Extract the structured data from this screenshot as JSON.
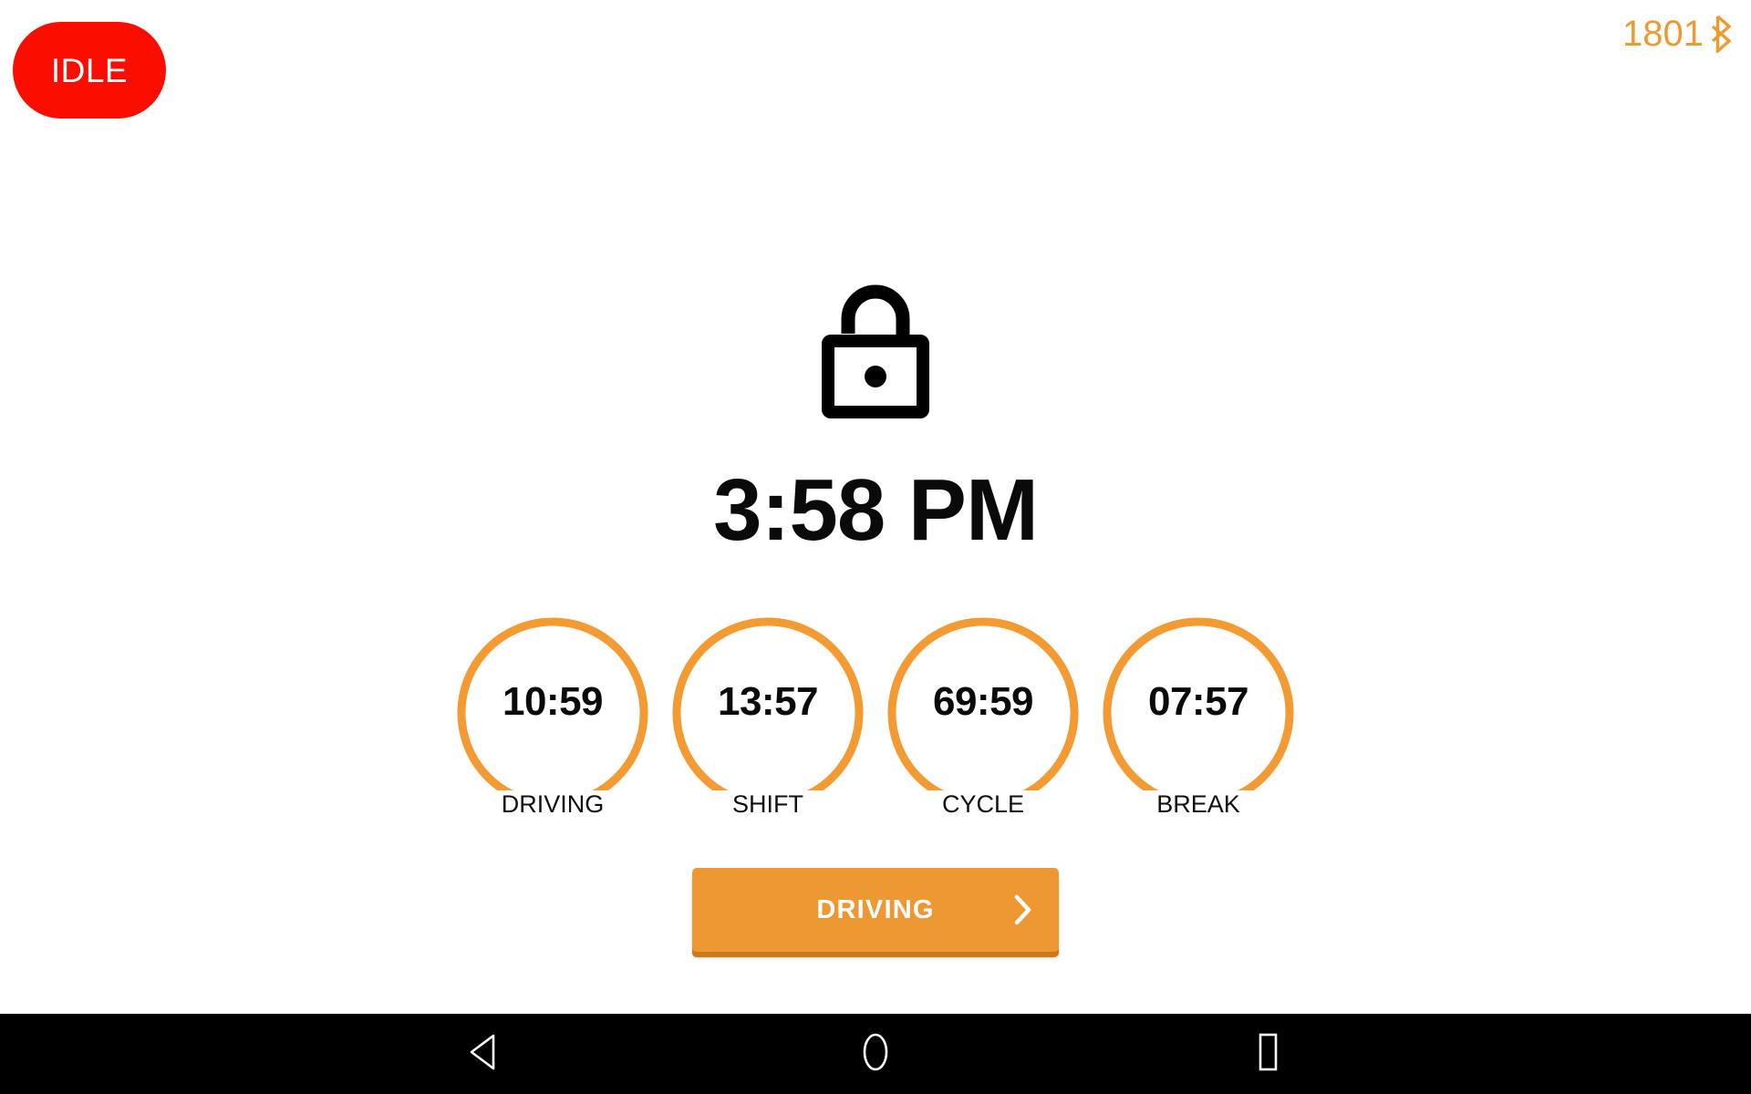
{
  "status_badge": {
    "label": "IDLE",
    "color": "#FB0D00",
    "text_color": "#FFFFFF"
  },
  "top_right": {
    "counter": "1801",
    "bluetooth_icon": "bluetooth-icon",
    "color": "#ED9A33"
  },
  "main": {
    "lock_icon": "unlocked-padlock-icon",
    "clock": "3:58 PM"
  },
  "gauges": [
    {
      "value": "10:59",
      "label": "DRIVING",
      "arc_color": "#F39A33",
      "marker_color": "#9A9A9A"
    },
    {
      "value": "13:57",
      "label": "SHIFT",
      "arc_color": "#F39A33",
      "marker_color": "#9A9A9A"
    },
    {
      "value": "69:59",
      "label": "CYCLE",
      "arc_color": "#F39A33",
      "marker_color": "#9A9A9A"
    },
    {
      "value": "07:57",
      "label": "BREAK",
      "arc_color": "#F39A33",
      "marker_color": "#9A9A9A"
    }
  ],
  "action_button": {
    "label": "DRIVING",
    "chevron_icon": "chevron-right-icon",
    "bg_color": "#EE9833",
    "shadow_color": "#C97A1B",
    "text_color": "#FFFFFF"
  },
  "navbar": {
    "bg_color": "#000000",
    "back_icon": "triangle-back-icon",
    "home_icon": "circle-home-icon",
    "recents_icon": "square-recents-icon"
  }
}
